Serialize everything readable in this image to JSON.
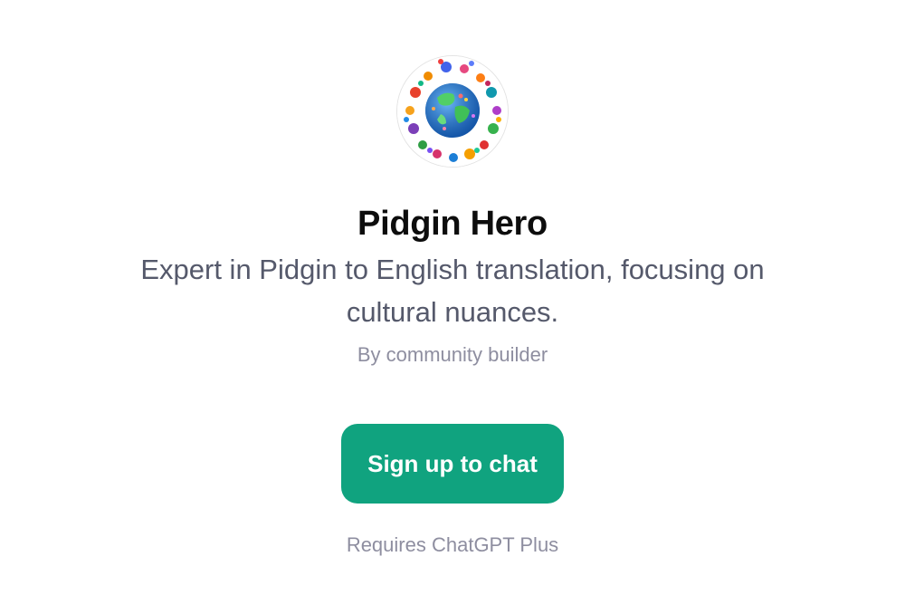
{
  "gpt": {
    "avatar_icon": "globe-splash-icon",
    "name": "Pidgin Hero",
    "description": "Expert in Pidgin to English translation, focusing on cultural nuances.",
    "author": "By community builder"
  },
  "cta": {
    "label": "Sign up to chat",
    "color": "#10a37f"
  },
  "footer": {
    "requirement": "Requires ChatGPT Plus"
  }
}
